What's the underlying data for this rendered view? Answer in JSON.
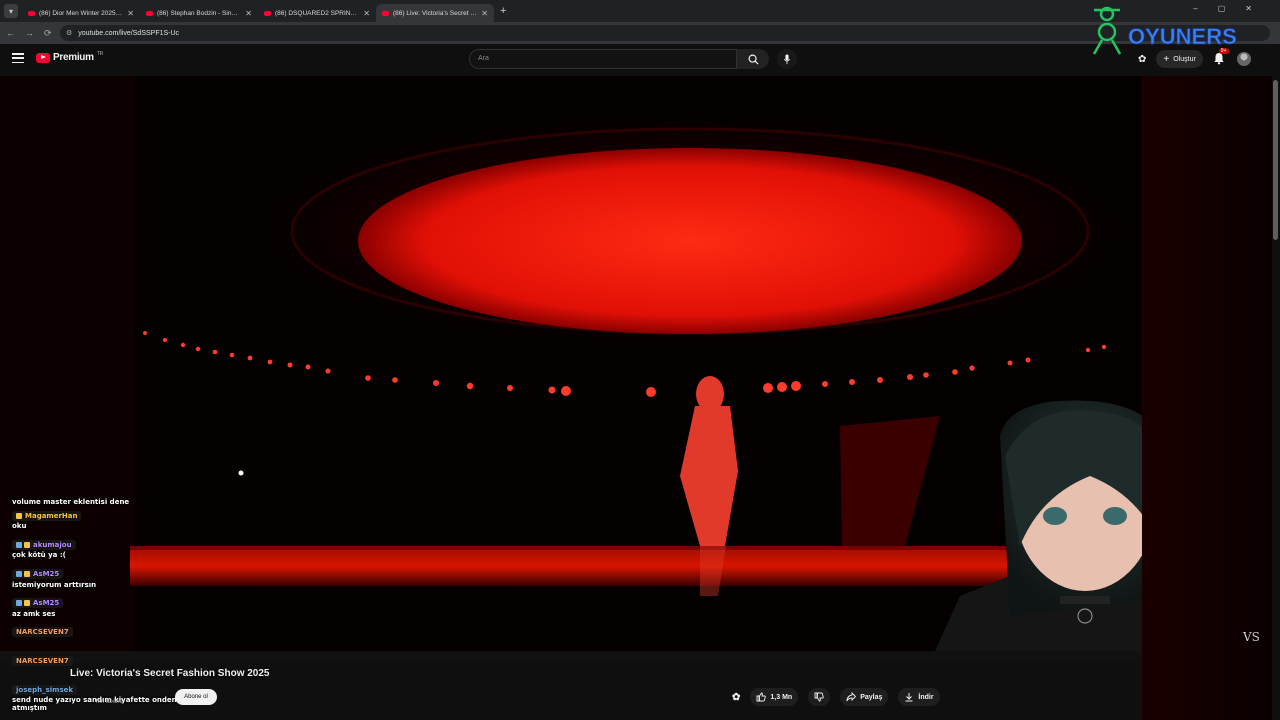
{
  "browser": {
    "tabs": [
      {
        "title": "(86) Dior Men Winter 2025-2026"
      },
      {
        "title": "(86) Stephan Bodzin - Singularity"
      },
      {
        "title": "(86) DSQUARED2 SPRING SUMMER"
      },
      {
        "title": "(86) Live: Victoria's Secret Fashion"
      }
    ],
    "url": "youtube.com/live/SdSSPF1S-Uc",
    "window_controls": [
      "–",
      "▢",
      "✕"
    ]
  },
  "overlay_logo": {
    "text": "OYUNERS"
  },
  "youtube": {
    "brand": "Premium",
    "country": "TR",
    "search_placeholder": "Ara",
    "create_label": "Oluştur",
    "notifications": "9+"
  },
  "video": {
    "title": "Live: Victoria's Secret Fashion Show 2025",
    "subscribers": "Mn abone",
    "subscribe_label": "Abone ol",
    "likes": "1,3 Mn",
    "share_label": "Paylaş",
    "download_label": "İndir",
    "watermark": "VS"
  },
  "chat": [
    {
      "user": null,
      "text": "volume master eklentisi dene"
    },
    {
      "user": "MagamerHan",
      "text": "oku",
      "color": "#f4c542"
    },
    {
      "user": "akumajou",
      "text": "çok kötü ya :(",
      "color": "#b48cff"
    },
    {
      "user": "AsM25",
      "text": "istemiyorum arttırsın",
      "color": "#b48cff"
    },
    {
      "user": "AsM25",
      "text": "az amk ses",
      "color": "#b48cff"
    },
    {
      "user": "NARCSEVEN7",
      "text": "",
      "color": "#f0a060"
    },
    {
      "user": "NARCSEVEN7",
      "text": "",
      "color": "#f0a060"
    },
    {
      "user": "joseph_simsek",
      "text": "send nude yazıyo sandım kiyafette onden atmıştım",
      "color": "#6fa8dc"
    }
  ],
  "colors": {
    "accent": "#ff0033",
    "stage": "#ff1a0a",
    "logo": "#22c55e",
    "logo_text": "#3b82f6"
  }
}
